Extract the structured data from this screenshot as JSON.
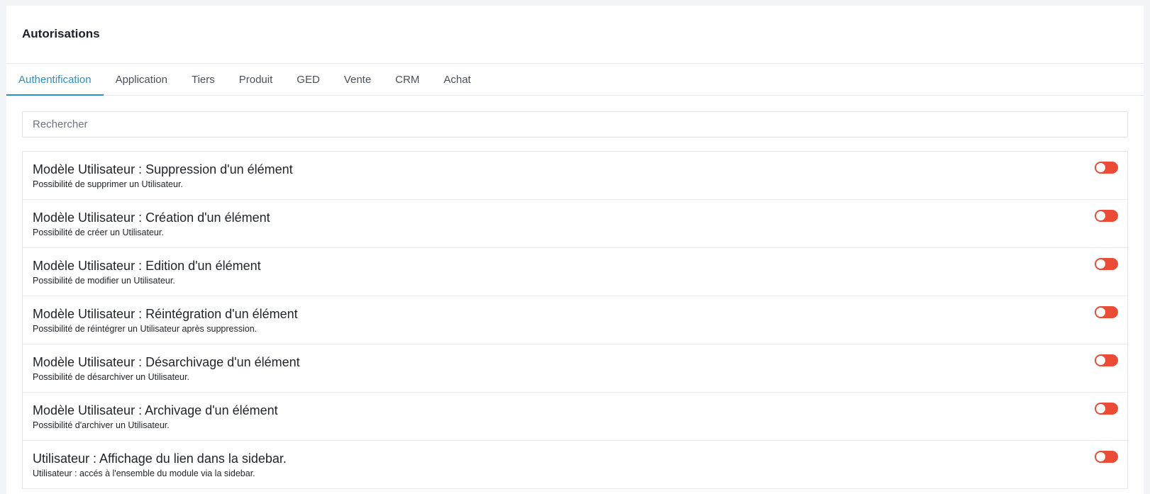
{
  "header": {
    "title": "Autorisations"
  },
  "tabs": [
    {
      "label": "Authentification",
      "active": true
    },
    {
      "label": "Application",
      "active": false
    },
    {
      "label": "Tiers",
      "active": false
    },
    {
      "label": "Produit",
      "active": false
    },
    {
      "label": "GED",
      "active": false
    },
    {
      "label": "Vente",
      "active": false
    },
    {
      "label": "CRM",
      "active": false
    },
    {
      "label": "Achat",
      "active": false
    }
  ],
  "search": {
    "placeholder": "Rechercher",
    "value": ""
  },
  "permissions": [
    {
      "title": "Modèle Utilisateur : Suppression d'un élément",
      "description": "Possibilité de supprimer un Utilisateur.",
      "enabled": false
    },
    {
      "title": "Modèle Utilisateur : Création d'un élément",
      "description": "Possibilité de créer un Utilisateur.",
      "enabled": false
    },
    {
      "title": "Modèle Utilisateur : Edition d'un élément",
      "description": "Possibilité de modifier un Utilisateur.",
      "enabled": false
    },
    {
      "title": "Modèle Utilisateur : Réintégration d'un élément",
      "description": "Possibilité de réintégrer un Utilisateur après suppression.",
      "enabled": false
    },
    {
      "title": "Modèle Utilisateur : Désarchivage d'un élément",
      "description": "Possibilité de désarchiver un Utilisateur.",
      "enabled": false
    },
    {
      "title": "Modèle Utilisateur : Archivage d'un élément",
      "description": "Possibilité d'archiver un Utilisateur.",
      "enabled": false
    },
    {
      "title": "Utilisateur : Affichage du lien dans la sidebar.",
      "description": "Utilisateur : accés à l'ensemble du module via la sidebar.",
      "enabled": false
    }
  ],
  "colors": {
    "accent": "#2c90c9",
    "toggle_off": "#e94b35",
    "background": "#f3f4f8"
  }
}
